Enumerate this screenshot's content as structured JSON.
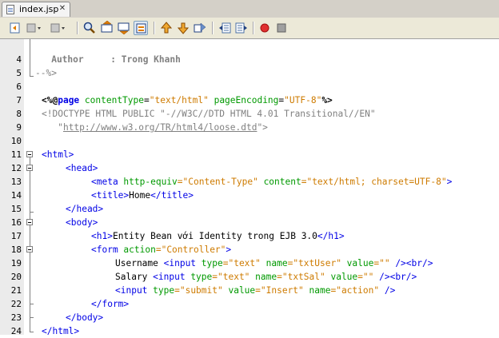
{
  "tab": {
    "label": "index.jsp",
    "close": "✕"
  },
  "toolbar": {
    "buttons": [
      "go-back",
      "go-forward",
      "last-edit",
      "find-selection",
      "find-previous",
      "find-next",
      "toggle-highlight",
      "shift-up",
      "shift-down",
      "select-word",
      "shift-left",
      "shift-right",
      "start-macro",
      "stop-macro"
    ]
  },
  "editor": {
    "line_numbers": [
      "4",
      "5",
      "6",
      "7",
      "8",
      "9",
      "10",
      "11",
      "12",
      "13",
      "14",
      "15",
      "16",
      "17",
      "18",
      "19",
      "20",
      "21",
      "22",
      "23",
      "24"
    ],
    "lines": {
      "l4_author": "   Author     : Trong Khanh",
      "l5": "--%>",
      "l7_open": "<%@",
      "l7_kw": "page",
      "l7_a1": " contentType",
      "l7_eq1": "=",
      "l7_v1": "\"text/html\"",
      "l7_a2": " pageEncoding",
      "l7_eq2": "=",
      "l7_v2": "\"UTF-8\"",
      "l7_close": "%>",
      "l8": "<!DOCTYPE HTML PUBLIC \"-//W3C//DTD HTML 4.01 Transitional//EN\"",
      "l9_pre": "   \"",
      "l9_url": "http://www.w3.org/TR/html4/loose.dtd",
      "l9_post": "\">",
      "l11": "<html>",
      "l12": "<head>",
      "l13_tag": "<meta",
      "l13_a1": " http-equiv",
      "l13_v1": "=\"Content-Type\"",
      "l13_a2": " content",
      "l13_v2": "=\"text/html; charset=UTF-8\"",
      "l13_end": ">",
      "l14_open": "<title>",
      "l14_text": "Home",
      "l14_close": "</title>",
      "l15": "</head>",
      "l16": "<body>",
      "l17_open": "<h1>",
      "l17_text": "Entity Bean với Identity trong EJB 3.0",
      "l17_close": "</h1>",
      "l18_tag": "<form",
      "l18_a1": " action",
      "l18_v1": "=\"Controller\"",
      "l18_end": ">",
      "l19_text": "Username ",
      "l19_tag": "<input",
      "l19_a1": " type",
      "l19_v1": "=\"text\"",
      "l19_a2": " name",
      "l19_v2": "=\"txtUser\"",
      "l19_a3": " value",
      "l19_v3": "=\"\"",
      "l19_end": " /><br/>",
      "l20_text": "Salary ",
      "l20_tag": "<input",
      "l20_a1": " type",
      "l20_v1": "=\"text\"",
      "l20_a2": " name",
      "l20_v2": "=\"txtSal\"",
      "l20_a3": " value",
      "l20_v3": "=\"\"",
      "l20_end": " /><br/>",
      "l21_tag": "<input",
      "l21_a1": " type",
      "l21_v1": "=\"submit\"",
      "l21_a2": " value",
      "l21_v2": "=\"Insert\"",
      "l21_a3": " name",
      "l21_v3": "=\"action\"",
      "l21_end": " />",
      "l22": "</form>",
      "l23": "</body>",
      "l24": "</html>"
    }
  },
  "colors": {
    "tag": "#0000e6",
    "attribute": "#009900",
    "value": "#ce7b00",
    "comment": "#808080",
    "gutter": "#ebebeb"
  }
}
